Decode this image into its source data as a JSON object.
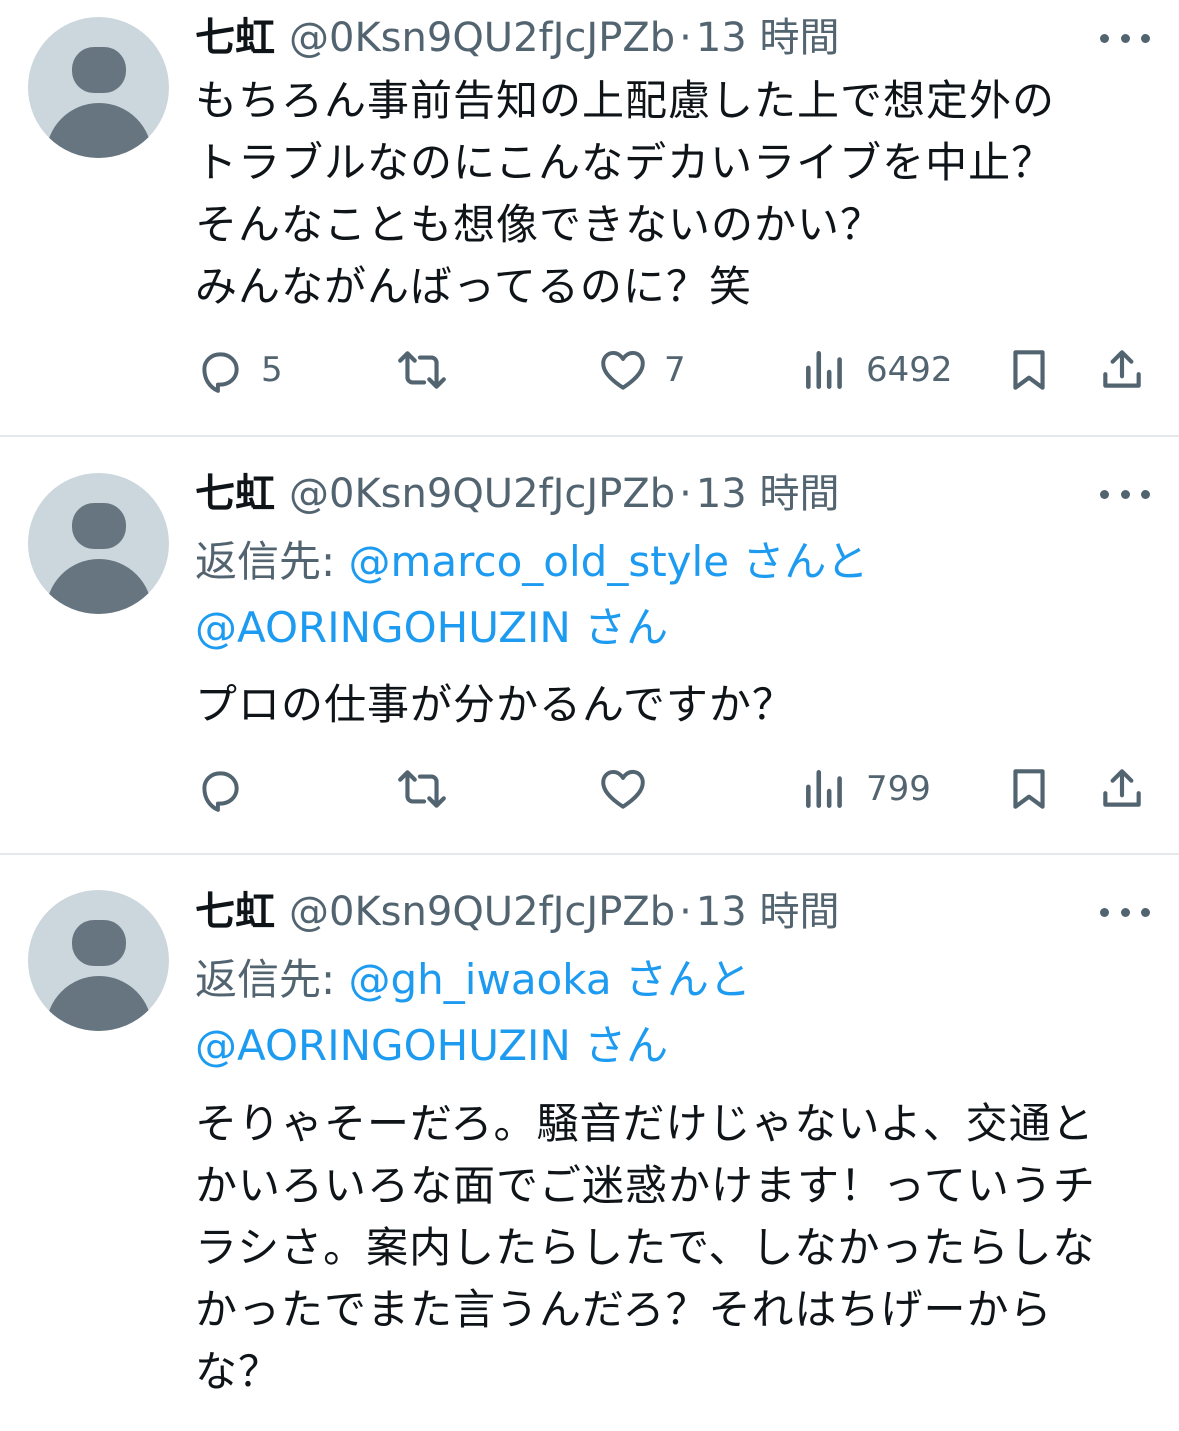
{
  "tweets": [
    {
      "name": "七虹",
      "handle": "@0Ksn9QU2fJcJPZb",
      "separator": "·",
      "time": "13 時間",
      "body": "もちろん事前告知の上配慮した上で想定外の\nトラブルなのにこんなデカいライブを中止？\nそんなことも想像できないのかい？\nみんながんばってるのに？笑",
      "reply_count": "5",
      "like_count": "7",
      "view_count": "6492"
    },
    {
      "name": "七虹",
      "handle": "@0Ksn9QU2fJcJPZb",
      "separator": "·",
      "time": "13 時間",
      "reply_prefix": "返信先: ",
      "reply_user1": "@marco_old_style さんと",
      "reply_user2": "@AORINGOHUZIN さん",
      "body": "プロの仕事が分かるんですか？",
      "view_count": "799"
    },
    {
      "name": "七虹",
      "handle": "@0Ksn9QU2fJcJPZb",
      "separator": "·",
      "time": "13 時間",
      "reply_prefix": "返信先: ",
      "reply_user1": "@gh_iwaoka さんと",
      "reply_user2": "@AORINGOHUZIN さん",
      "body": "そりゃそーだろ。騒音だけじゃないよ、交通と\nかいろいろな面でご迷惑かけます！っていうチ\nラシさ。案内したらしたで、しなかったらしな\nかったでまた言うんだろ？それはちげーから\nな？"
    }
  ],
  "icons": {
    "reply": "reply-icon",
    "retweet": "retweet-icon",
    "like": "heart-icon",
    "views": "views-icon",
    "bookmark": "bookmark-icon",
    "share": "share-icon",
    "more": "more-icon"
  },
  "colors": {
    "text": "#0f1419",
    "secondary": "#536471",
    "link": "#1d9bf0",
    "avatar_bg": "#ccd6dd",
    "avatar_fg": "#66757f"
  }
}
